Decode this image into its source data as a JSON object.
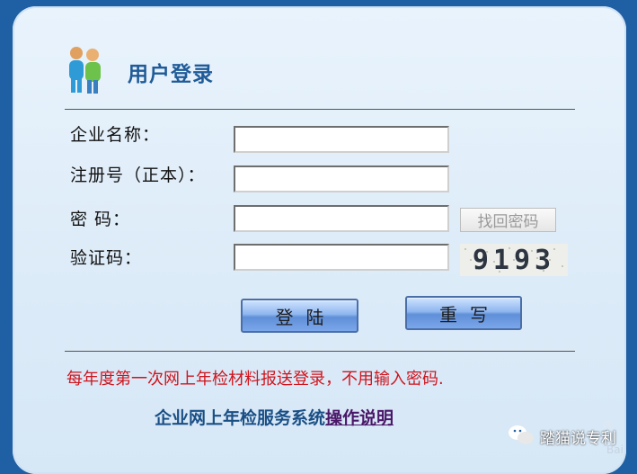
{
  "login": {
    "title": "用户登录",
    "fields": {
      "company_label": "企业名称：",
      "company_value": "",
      "regno_label": "注册号（正本）：",
      "regno_value": "",
      "password_label": "密 码：",
      "password_value": "",
      "captcha_label": "验证码：",
      "captcha_value": ""
    },
    "find_password": "找回密码",
    "captcha_image_text": "9193",
    "buttons": {
      "login": "登陆",
      "reset": "重写"
    },
    "notice": "每年度第一次网上年检材料报送登录，不用输入密码.",
    "footer": {
      "system_name": "企业网上年检服务系统",
      "guide_link": "操作说明"
    }
  },
  "watermark": {
    "text": "踏猫说专利",
    "small": "转",
    "baidu": "Bai"
  },
  "colors": {
    "frame": "#1f5fa3",
    "title": "#1f5b98",
    "notice": "#d0141c",
    "guide_link": "#4a1768"
  }
}
